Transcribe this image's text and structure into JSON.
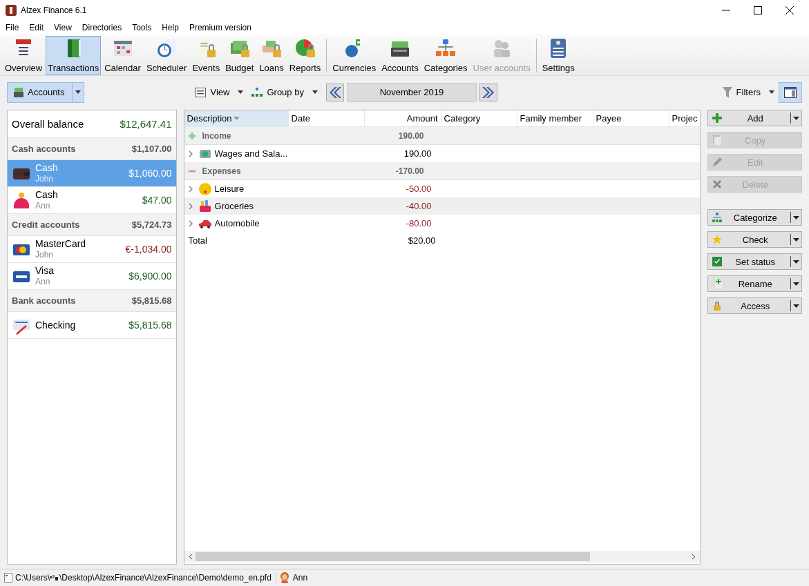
{
  "window": {
    "title": "Alzex Finance 6.1"
  },
  "menu": [
    "File",
    "Edit",
    "View",
    "Directories",
    "Tools",
    "Help",
    "Premium version"
  ],
  "toolbar": [
    {
      "label": "Overview",
      "selected": false,
      "disabled": false
    },
    {
      "label": "Transactions",
      "selected": true,
      "disabled": false
    },
    {
      "label": "Calendar",
      "selected": false,
      "disabled": false
    },
    {
      "label": "Scheduler",
      "selected": false,
      "disabled": false
    },
    {
      "label": "Events",
      "selected": false,
      "disabled": false
    },
    {
      "label": "Budget",
      "selected": false,
      "disabled": false
    },
    {
      "label": "Loans",
      "selected": false,
      "disabled": false
    },
    {
      "label": "Reports",
      "selected": false,
      "disabled": false
    },
    {
      "label": "Currencies",
      "selected": false,
      "disabled": false
    },
    {
      "label": "Accounts",
      "selected": false,
      "disabled": false
    },
    {
      "label": "Categories",
      "selected": false,
      "disabled": false
    },
    {
      "label": "User accounts",
      "selected": false,
      "disabled": true
    },
    {
      "label": "Settings",
      "selected": false,
      "disabled": false
    }
  ],
  "subbar": {
    "accounts": {
      "label": "Accounts",
      "selected": true
    },
    "view": "View",
    "group_by": "Group by",
    "period": "November 2019",
    "filters": "Filters",
    "layout_toggle": {
      "selected": true
    }
  },
  "accounts": {
    "overall": {
      "label": "Overall balance",
      "amount": "$12,647.41"
    },
    "groups": [
      {
        "name": "Cash accounts",
        "total": "$1,107.00",
        "items": [
          {
            "name": "Cash",
            "owner": "John",
            "amount": "$1,060.00",
            "negative": false,
            "selected": true
          },
          {
            "name": "Cash",
            "owner": "Ann",
            "amount": "$47.00",
            "negative": false,
            "selected": false
          }
        ]
      },
      {
        "name": "Credit accounts",
        "total": "$5,724.73",
        "items": [
          {
            "name": "MasterCard",
            "owner": "John",
            "amount": "€-1,034.00",
            "negative": true,
            "selected": false
          },
          {
            "name": "Visa",
            "owner": "Ann",
            "amount": "$6,900.00",
            "negative": false,
            "selected": false
          }
        ]
      },
      {
        "name": "Bank accounts",
        "total": "$5,815.68",
        "items": [
          {
            "name": "Checking",
            "amount": "$5,815.68",
            "negative": false,
            "selected": false
          }
        ]
      }
    ]
  },
  "table": {
    "columns": [
      {
        "label": "Description",
        "sorted": true
      },
      {
        "label": "Date",
        "sorted": false
      },
      {
        "label": "Amount",
        "sorted": false
      },
      {
        "label": "Category",
        "sorted": false
      },
      {
        "label": "Family member",
        "sorted": false
      },
      {
        "label": "Payee",
        "sorted": false
      },
      {
        "label": "Projec",
        "sorted": false
      }
    ],
    "rows": [
      {
        "kind": "group",
        "label": "Income",
        "amount": "190.00"
      },
      {
        "kind": "item",
        "label": "Wages and Sala...",
        "amount": "190.00",
        "negative": false,
        "selected": false
      },
      {
        "kind": "group",
        "label": "Expenses",
        "amount": "-170.00"
      },
      {
        "kind": "item",
        "label": "Leisure",
        "amount": "-50.00",
        "negative": true,
        "selected": false
      },
      {
        "kind": "item",
        "label": "Groceries",
        "amount": "-40.00",
        "negative": true,
        "selected": true
      },
      {
        "kind": "item",
        "label": "Automobile",
        "amount": "-80.00",
        "negative": true,
        "selected": false
      },
      {
        "kind": "total",
        "label": "Total",
        "amount": "$20.00"
      }
    ]
  },
  "actions": [
    {
      "label": "Add",
      "disabled": false,
      "dropdown": true
    },
    {
      "label": "Copy",
      "disabled": true,
      "dropdown": false
    },
    {
      "label": "Edit",
      "disabled": true,
      "dropdown": false
    },
    {
      "label": "Delete",
      "disabled": true,
      "dropdown": false
    },
    {
      "label": "Categorize",
      "disabled": false,
      "dropdown": true
    },
    {
      "label": "Check",
      "disabled": false,
      "dropdown": true
    },
    {
      "label": "Set status",
      "disabled": false,
      "dropdown": true
    },
    {
      "label": "Rename",
      "disabled": false,
      "dropdown": true
    },
    {
      "label": "Access",
      "disabled": false,
      "dropdown": true
    }
  ],
  "status_bar": {
    "path_start": "C:\\Users\\",
    "path_end": "\\Desktop\\AlzexFinance\\AlzexFinance\\Demo\\demo_en.pfd",
    "user": "Ann"
  }
}
